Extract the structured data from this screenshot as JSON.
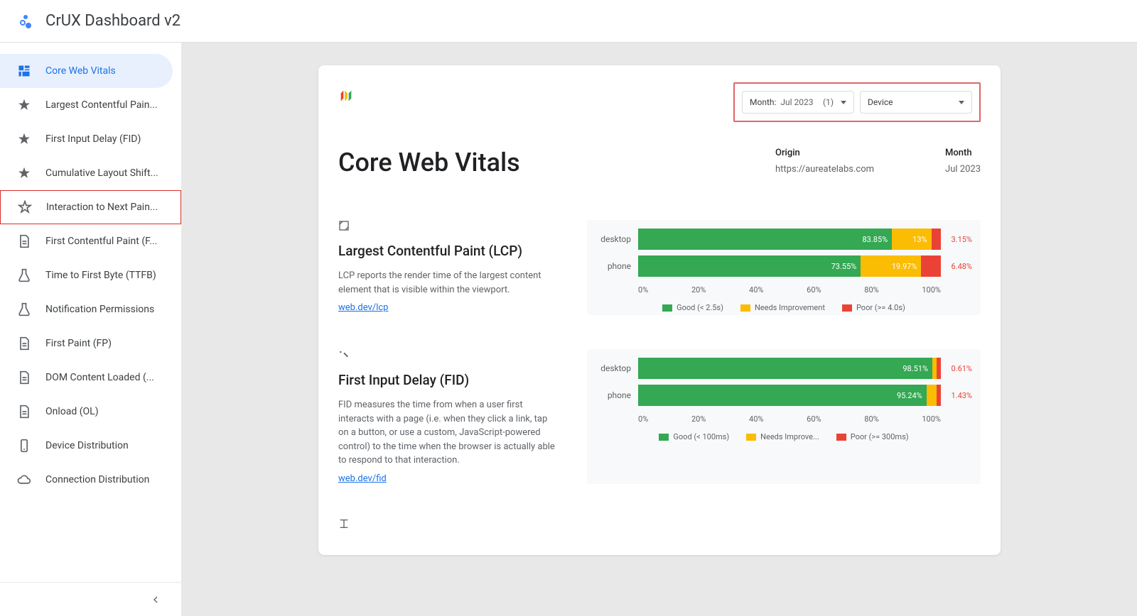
{
  "app": {
    "title": "CrUX Dashboard v2"
  },
  "sidebar": {
    "items": [
      {
        "label": "Core Web Vitals",
        "icon": "dashboard"
      },
      {
        "label": "Largest Contentful Pain...",
        "icon": "star"
      },
      {
        "label": "First Input Delay (FID)",
        "icon": "star"
      },
      {
        "label": "Cumulative Layout Shift...",
        "icon": "star"
      },
      {
        "label": "Interaction to Next Pain...",
        "icon": "star-outline"
      },
      {
        "label": "First Contentful Paint (F...",
        "icon": "doc"
      },
      {
        "label": "Time to First Byte (TTFB)",
        "icon": "flask"
      },
      {
        "label": "Notification Permissions",
        "icon": "flask"
      },
      {
        "label": "First Paint (FP)",
        "icon": "doc"
      },
      {
        "label": "DOM Content Loaded (...",
        "icon": "doc"
      },
      {
        "label": "Onload (OL)",
        "icon": "doc"
      },
      {
        "label": "Device Distribution",
        "icon": "device"
      },
      {
        "label": "Connection Distribution",
        "icon": "cloud"
      }
    ]
  },
  "filters": {
    "month_label": "Month:",
    "month_value": "Jul 2023",
    "month_count": "(1)",
    "device_label": "Device"
  },
  "report": {
    "title": "Core Web Vitals",
    "origin_label": "Origin",
    "origin_value": "https://aureatelabs.com",
    "month_label": "Month",
    "month_value": "Jul 2023"
  },
  "axis": [
    "0%",
    "20%",
    "40%",
    "60%",
    "80%",
    "100%"
  ],
  "metrics": [
    {
      "title": "Largest Contentful Paint (LCP)",
      "desc": "LCP reports the render time of the largest content element that is visible within the viewport.",
      "link": "web.dev/lcp",
      "legend": {
        "good": "Good (< 2.5s)",
        "ni": "Needs Improvement",
        "poor": "Poor (>= 4.0s)"
      },
      "rows": [
        {
          "label": "desktop",
          "good": "83.85%",
          "ni": "13%",
          "poor": "3.15%",
          "good_w": 83.85,
          "ni_w": 13,
          "poor_w": 3.15
        },
        {
          "label": "phone",
          "good": "73.55%",
          "ni": "19.97%",
          "poor": "6.48%",
          "good_w": 73.55,
          "ni_w": 19.97,
          "poor_w": 6.48
        }
      ]
    },
    {
      "title": "First Input Delay (FID)",
      "desc": "FID measures the time from when a user first interacts with a page (i.e. when they click a link, tap on a button, or use a custom, JavaScript-powered control) to the time when the browser is actually able to respond to that interaction.",
      "link": "web.dev/fid",
      "legend": {
        "good": "Good (< 100ms)",
        "ni": "Needs Improve...",
        "poor": "Poor (>= 300ms)"
      },
      "rows": [
        {
          "label": "desktop",
          "good": "98.51%",
          "ni": "0.88%",
          "poor": "0.61%",
          "good_w": 98.51,
          "ni_w": 0.88,
          "poor_w": 0.61,
          "ni_overlap": "0.88%"
        },
        {
          "label": "phone",
          "good": "95.24%",
          "ni": "3.43%",
          "poor": "1.43%",
          "good_w": 95.24,
          "ni_w": 3.33,
          "poor_w": 1.43,
          "ni_overlap": "3.63%"
        }
      ]
    }
  ],
  "chart_data": [
    {
      "type": "bar",
      "title": "Largest Contentful Paint (LCP)",
      "categories": [
        "desktop",
        "phone"
      ],
      "series": [
        {
          "name": "Good (< 2.5s)",
          "values": [
            83.85,
            73.55
          ]
        },
        {
          "name": "Needs Improvement",
          "values": [
            13,
            19.97
          ]
        },
        {
          "name": "Poor (>= 4.0s)",
          "values": [
            3.15,
            6.48
          ]
        }
      ],
      "xlabel": "",
      "ylabel": "",
      "xlim": [
        0,
        100
      ]
    },
    {
      "type": "bar",
      "title": "First Input Delay (FID)",
      "categories": [
        "desktop",
        "phone"
      ],
      "series": [
        {
          "name": "Good (< 100ms)",
          "values": [
            98.51,
            95.24
          ]
        },
        {
          "name": "Needs Improvement",
          "values": [
            0.88,
            3.33
          ]
        },
        {
          "name": "Poor (>= 300ms)",
          "values": [
            0.61,
            1.43
          ]
        }
      ],
      "xlabel": "",
      "ylabel": "",
      "xlim": [
        0,
        100
      ]
    }
  ]
}
